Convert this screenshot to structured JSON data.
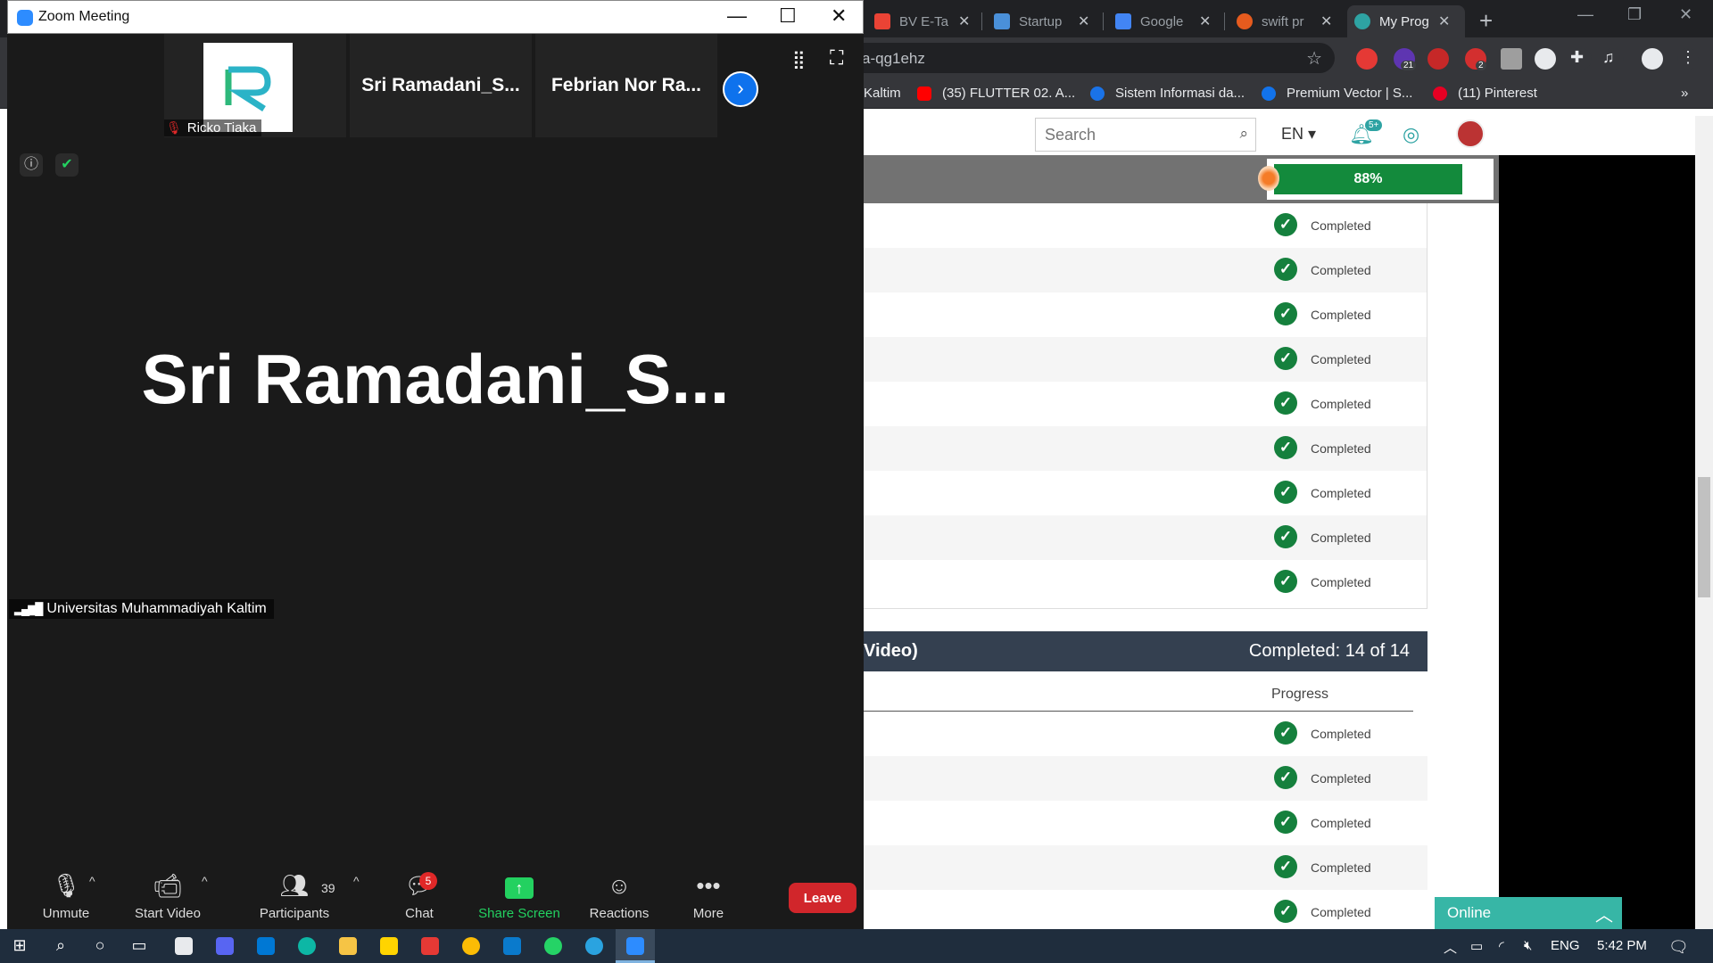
{
  "browser": {
    "tabs": [
      {
        "label": "BV E-Tal",
        "icon": "gmail-icon",
        "color": "#ea4335"
      },
      {
        "label": "Startup",
        "icon": "startup-favicon",
        "color": "#4a90d9"
      },
      {
        "label": "Google",
        "icon": "google-translate-icon",
        "color": "#4285f4"
      },
      {
        "label": "swift pr",
        "icon": "brave-search-icon",
        "color": "#e65b1e"
      },
      {
        "label": "My Prog",
        "icon": "site-favicon",
        "color": "#2ea3a3",
        "active": true
      }
    ],
    "url": "a-qg1ehz",
    "extension_badges": {
      "counter": "21",
      "notes": "2"
    },
    "bookmarks": [
      {
        "label": "Kaltim",
        "icon": "blank"
      },
      {
        "label": "(35) FLUTTER 02. A...",
        "icon": "youtube-icon",
        "color": "#ff0000"
      },
      {
        "label": "Sistem Informasi da...",
        "icon": "blue-bird-icon",
        "color": "#1a73e8"
      },
      {
        "label": "Premium Vector | S...",
        "icon": "freepik-icon",
        "color": "#1273eb"
      },
      {
        "label": "(11) Pinterest",
        "icon": "pinterest-icon",
        "color": "#e60023"
      }
    ],
    "more_bookmarks": "»"
  },
  "site": {
    "search_placeholder": "Search",
    "language": "EN",
    "notif_badge": "5+",
    "progress": {
      "percent": 88,
      "label": "88%"
    },
    "list1_status": [
      "Completed",
      "Completed",
      "Completed",
      "Completed",
      "Completed",
      "Completed",
      "Completed",
      "Completed",
      "Completed"
    ],
    "section2": {
      "title": "Video)",
      "completed": "Completed: 14 of 14",
      "column": "Progress"
    },
    "list2_status": [
      "Completed",
      "Completed",
      "Completed",
      "Completed",
      "Completed"
    ],
    "chat_widget": "Online"
  },
  "zoom": {
    "window_title": "Zoom Meeting",
    "tiles": [
      {
        "name": "Ricko Tiaka",
        "type": "logo"
      },
      {
        "name": "Sri  Ramadani_S..."
      },
      {
        "name": "Febrian Nor Ra..."
      }
    ],
    "active_speaker": "Sri  Ramadani_S...",
    "network_label": "Universitas Muhammadiyah Kaltim",
    "controls": {
      "unmute": "Unmute",
      "start_video": "Start Video",
      "participants": "Participants",
      "participant_count": "39",
      "chat": "Chat",
      "chat_badge": "5",
      "share_screen": "Share Screen",
      "reactions": "Reactions",
      "more": "More",
      "leave": "Leave"
    },
    "accent": "#0e72ed",
    "share_color": "#23d160"
  },
  "taskbar": {
    "language": "ENG",
    "time": "5:42 PM"
  }
}
